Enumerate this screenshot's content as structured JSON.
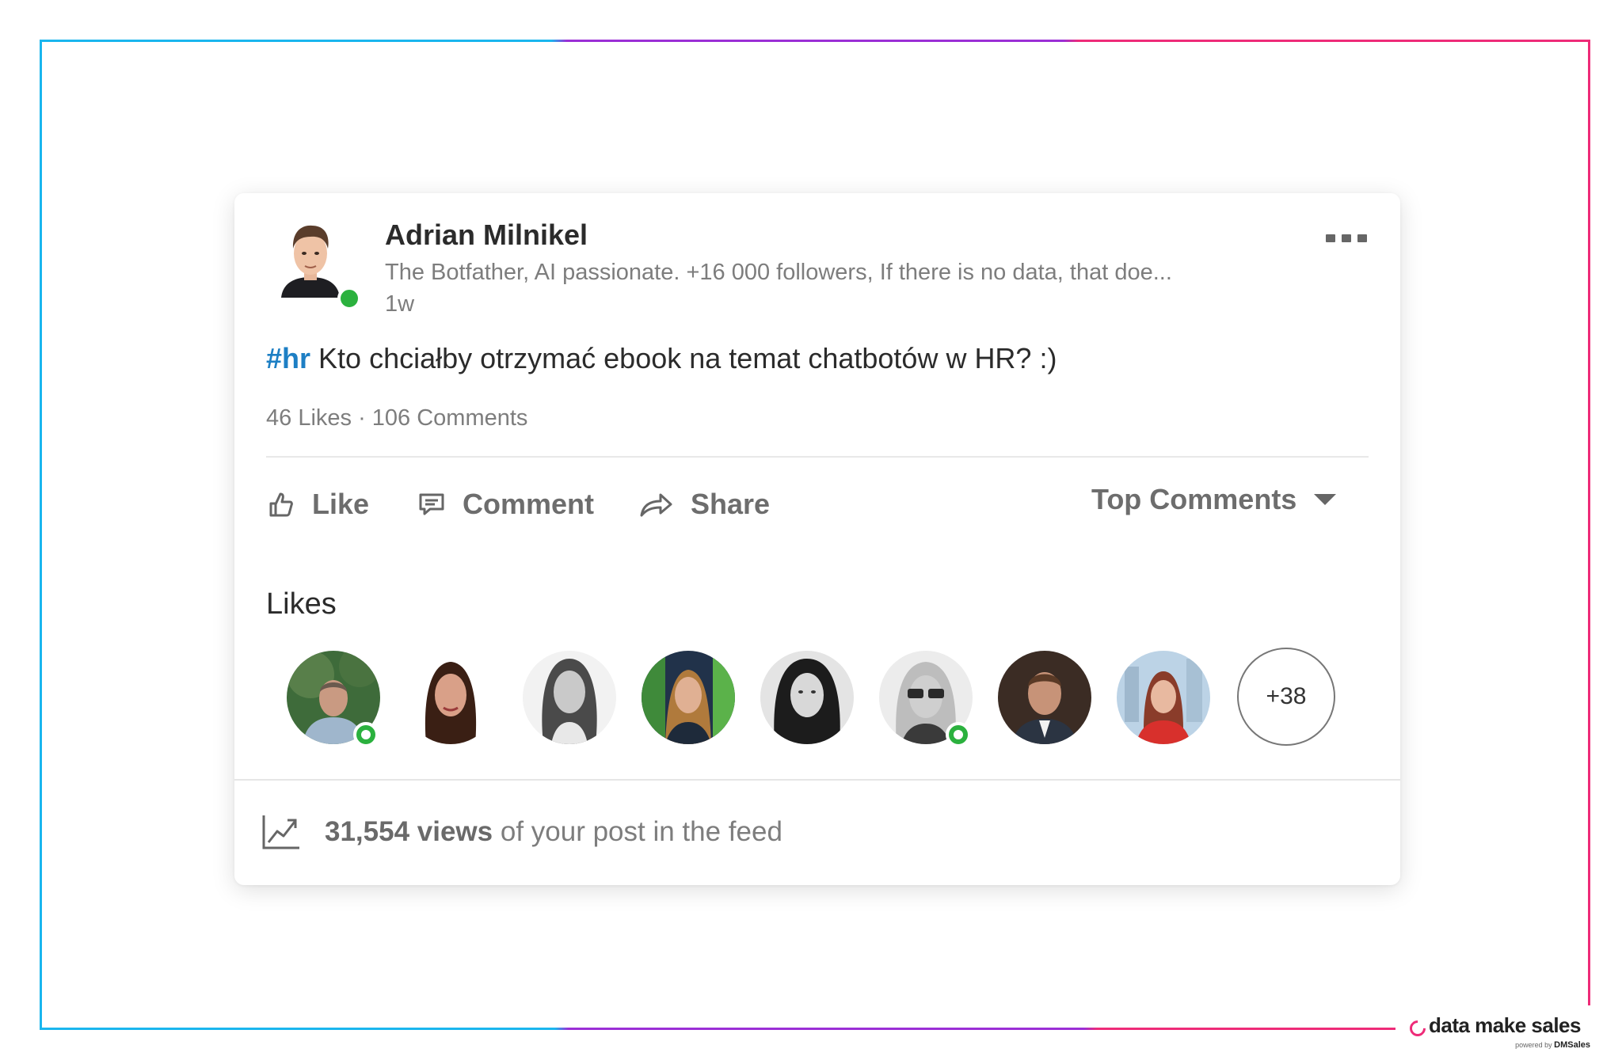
{
  "post": {
    "author_name": "Adrian Milnikel",
    "author_headline": "The Botfather, AI passionate. +16 000 followers, If there is no data, that doe...",
    "time": "1w",
    "hashtag": "#hr",
    "text": " Kto chciałby otrzymać ebook na temat chatbotów w HR? :)",
    "counts": "46 Likes · 106 Comments",
    "author_online": true
  },
  "actions": {
    "like": "Like",
    "comment": "Comment",
    "share": "Share",
    "sort": "Top Comments"
  },
  "likes": {
    "title": "Likes",
    "more_count": "+38",
    "avatars": [
      {
        "name": "liker-1",
        "online": true
      },
      {
        "name": "liker-2",
        "online": false
      },
      {
        "name": "liker-3",
        "online": false
      },
      {
        "name": "liker-4",
        "online": false
      },
      {
        "name": "liker-5",
        "online": false
      },
      {
        "name": "liker-6",
        "online": true
      },
      {
        "name": "liker-7",
        "online": false
      },
      {
        "name": "liker-8",
        "online": false
      }
    ]
  },
  "stats": {
    "views_count": "31,554 views",
    "views_suffix": " of your post in the feed"
  },
  "brand": {
    "name": "data make sales",
    "powered_by": "powered by",
    "powered_name": "DMSales"
  },
  "colors": {
    "hashtag": "#1d7fc4",
    "online": "#2bb13e",
    "frame_blue": "#1ab6ee",
    "frame_purple": "#9b2fd6",
    "frame_pink": "#ee2b78"
  }
}
